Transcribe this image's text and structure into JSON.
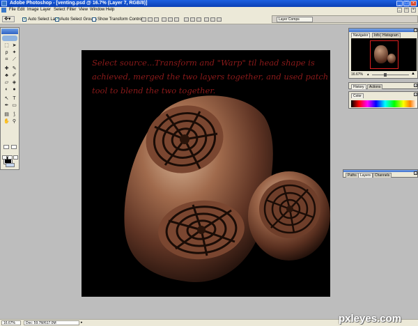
{
  "window": {
    "title": "Adobe Photoshop - [venting.psd @ 16.7% (Layer 7, RGB/8)]",
    "minimize_icon": "minimize-icon",
    "maximize_icon": "maximize-icon",
    "close_icon": "close-icon"
  },
  "menu": {
    "items": [
      "File",
      "Edit",
      "Image",
      "Layer",
      "Select",
      "Filter",
      "View",
      "Window",
      "Help"
    ]
  },
  "options_bar": {
    "tool_icon": "move-tool-icon",
    "auto_select_layer": {
      "label": "Auto Select Layer",
      "checked": true
    },
    "auto_select_groups": {
      "label": "Auto Select Groups",
      "checked": true
    },
    "show_transform_controls": {
      "label": "Show Transform Controls",
      "checked": false
    },
    "palette_well_tab": "Layer Comps"
  },
  "toolbox": {
    "foreground_color": "#000000",
    "background_color": "#ffffff"
  },
  "canvas": {
    "overlay_text": "Select source...Transform and \"Warp\" til head shape is achieved, merged the two layers together, and used patch tool to blend the two together.",
    "overlay_text_color": "#8b1a1a",
    "background": "#000000"
  },
  "navigator_palette": {
    "tabs": [
      "Navigator",
      "Info",
      "Histogram"
    ],
    "zoom_value": "16.67%"
  },
  "history_palette": {
    "tabs": [
      "History",
      "Actions"
    ]
  },
  "color_palette": {
    "tabs": [
      "Color"
    ]
  },
  "layers_palette": {
    "tabs": [
      "Paths",
      "Layers",
      "Channels"
    ]
  },
  "status_bar": {
    "zoom": "16.67%",
    "doc_info": "Doc: 59.7M/617.0M"
  },
  "watermark": "pxleyes.com"
}
